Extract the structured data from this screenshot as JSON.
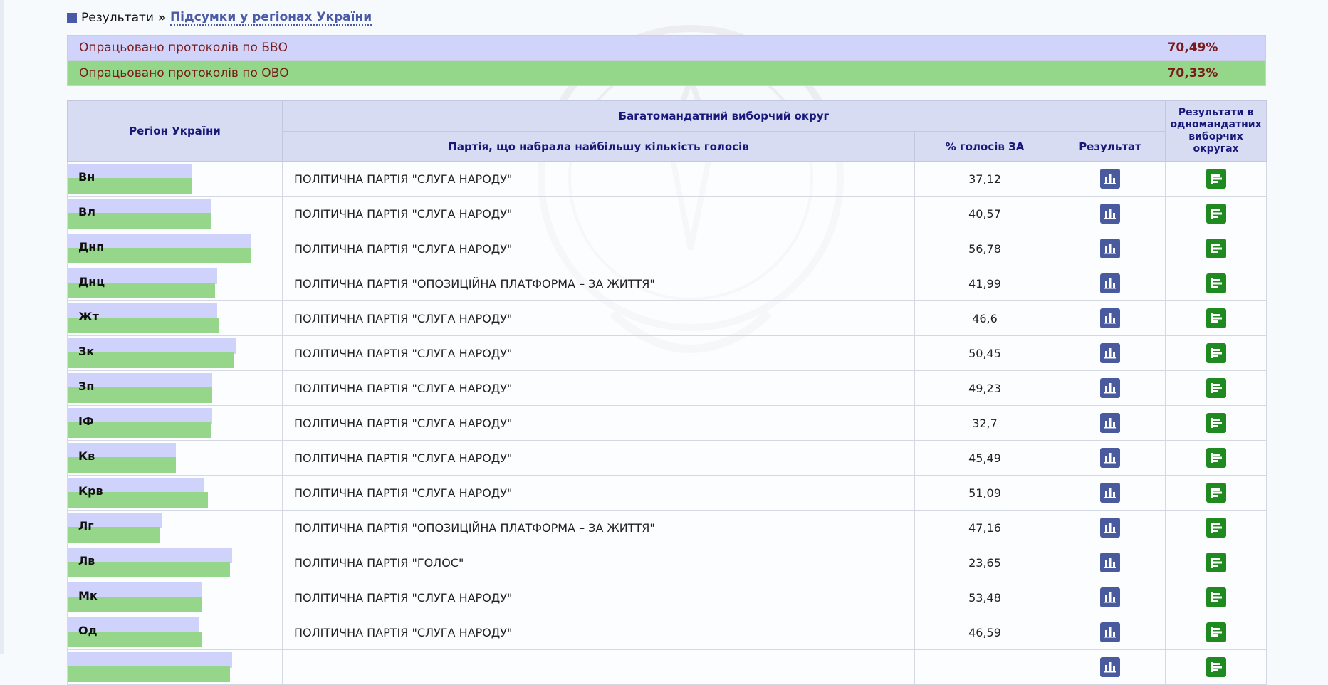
{
  "breadcrumb": {
    "root": "Результати",
    "separator": "»",
    "current": "Підсумки у регіонах України"
  },
  "progress": [
    {
      "label": "Опрацьовано протоколів по БВО",
      "value": "70,49%"
    },
    {
      "label": "Опрацьовано протоколів по ОВО",
      "value": "70,33%"
    }
  ],
  "table": {
    "headers": {
      "region": "Регіон України",
      "multi_district": "Багатомандатний виборчий округ",
      "party": "Партія, що набрала найбільшу кількість голосів",
      "percent": "% голосів ЗА",
      "result": "Результат",
      "single_results": "Результати в одномандатних виборчих округах"
    },
    "rows": [
      {
        "region": "Вн",
        "party": "ПОЛІТИЧНА ПАРТІЯ \"СЛУГА НАРОДУ\"",
        "percent": "37,12",
        "bvo_progress": 0.58,
        "ovo_progress": 0.58
      },
      {
        "region": "Вл",
        "party": "ПОЛІТИЧНА ПАРТІЯ \"СЛУГА НАРОДУ\"",
        "percent": "40,57",
        "bvo_progress": 0.67,
        "ovo_progress": 0.67
      },
      {
        "region": "Днп",
        "party": "ПОЛІТИЧНА ПАРТІЯ \"СЛУГА НАРОДУ\"",
        "percent": "56,78",
        "bvo_progress": 0.855,
        "ovo_progress": 0.86
      },
      {
        "region": "Днц",
        "party": "ПОЛІТИЧНА ПАРТІЯ \"ОПОЗИЦІЙНА ПЛАТФОРМА – ЗА ЖИТТЯ\"",
        "percent": "41,99",
        "bvo_progress": 0.7,
        "ovo_progress": 0.69
      },
      {
        "region": "Жт",
        "party": "ПОЛІТИЧНА ПАРТІЯ \"СЛУГА НАРОДУ\"",
        "percent": "46,6",
        "bvo_progress": 0.7,
        "ovo_progress": 0.705
      },
      {
        "region": "Зк",
        "party": "ПОЛІТИЧНА ПАРТІЯ \"СЛУГА НАРОДУ\"",
        "percent": "50,45",
        "bvo_progress": 0.785,
        "ovo_progress": 0.775
      },
      {
        "region": "Зп",
        "party": "ПОЛІТИЧНА ПАРТІЯ \"СЛУГА НАРОДУ\"",
        "percent": "49,23",
        "bvo_progress": 0.675,
        "ovo_progress": 0.675
      },
      {
        "region": "ІФ",
        "party": "ПОЛІТИЧНА ПАРТІЯ \"СЛУГА НАРОДУ\"",
        "percent": "32,7",
        "bvo_progress": 0.675,
        "ovo_progress": 0.67
      },
      {
        "region": "Кв",
        "party": "ПОЛІТИЧНА ПАРТІЯ \"СЛУГА НАРОДУ\"",
        "percent": "45,49",
        "bvo_progress": 0.505,
        "ovo_progress": 0.505
      },
      {
        "region": "Крв",
        "party": "ПОЛІТИЧНА ПАРТІЯ \"СЛУГА НАРОДУ\"",
        "percent": "51,09",
        "bvo_progress": 0.64,
        "ovo_progress": 0.655
      },
      {
        "region": "Лг",
        "party": "ПОЛІТИЧНА ПАРТІЯ \"ОПОЗИЦІЙНА ПЛАТФОРМА – ЗА ЖИТТЯ\"",
        "percent": "47,16",
        "bvo_progress": 0.44,
        "ovo_progress": 0.43
      },
      {
        "region": "Лв",
        "party": "ПОЛІТИЧНА ПАРТІЯ \"ГОЛОС\"",
        "percent": "23,65",
        "bvo_progress": 0.77,
        "ovo_progress": 0.76
      },
      {
        "region": "Мк",
        "party": "ПОЛІТИЧНА ПАРТІЯ \"СЛУГА НАРОДУ\"",
        "percent": "53,48",
        "bvo_progress": 0.63,
        "ovo_progress": 0.63
      },
      {
        "region": "Од",
        "party": "ПОЛІТИЧНА ПАРТІЯ \"СЛУГА НАРОДУ\"",
        "percent": "46,59",
        "bvo_progress": 0.615,
        "ovo_progress": 0.63
      },
      {
        "region": "",
        "party": "",
        "percent": "",
        "bvo_progress": 0.77,
        "ovo_progress": 0.76
      }
    ]
  },
  "icons": {
    "result": "bar-chart-icon",
    "single_results": "horizontal-bar-chart-icon"
  },
  "colors": {
    "accent": "#4b5aa6",
    "bvo": "#d0d3fa",
    "ovo": "#94d78a",
    "result_icon": "#4a5a9e",
    "single_icon": "#1f8a1f"
  }
}
